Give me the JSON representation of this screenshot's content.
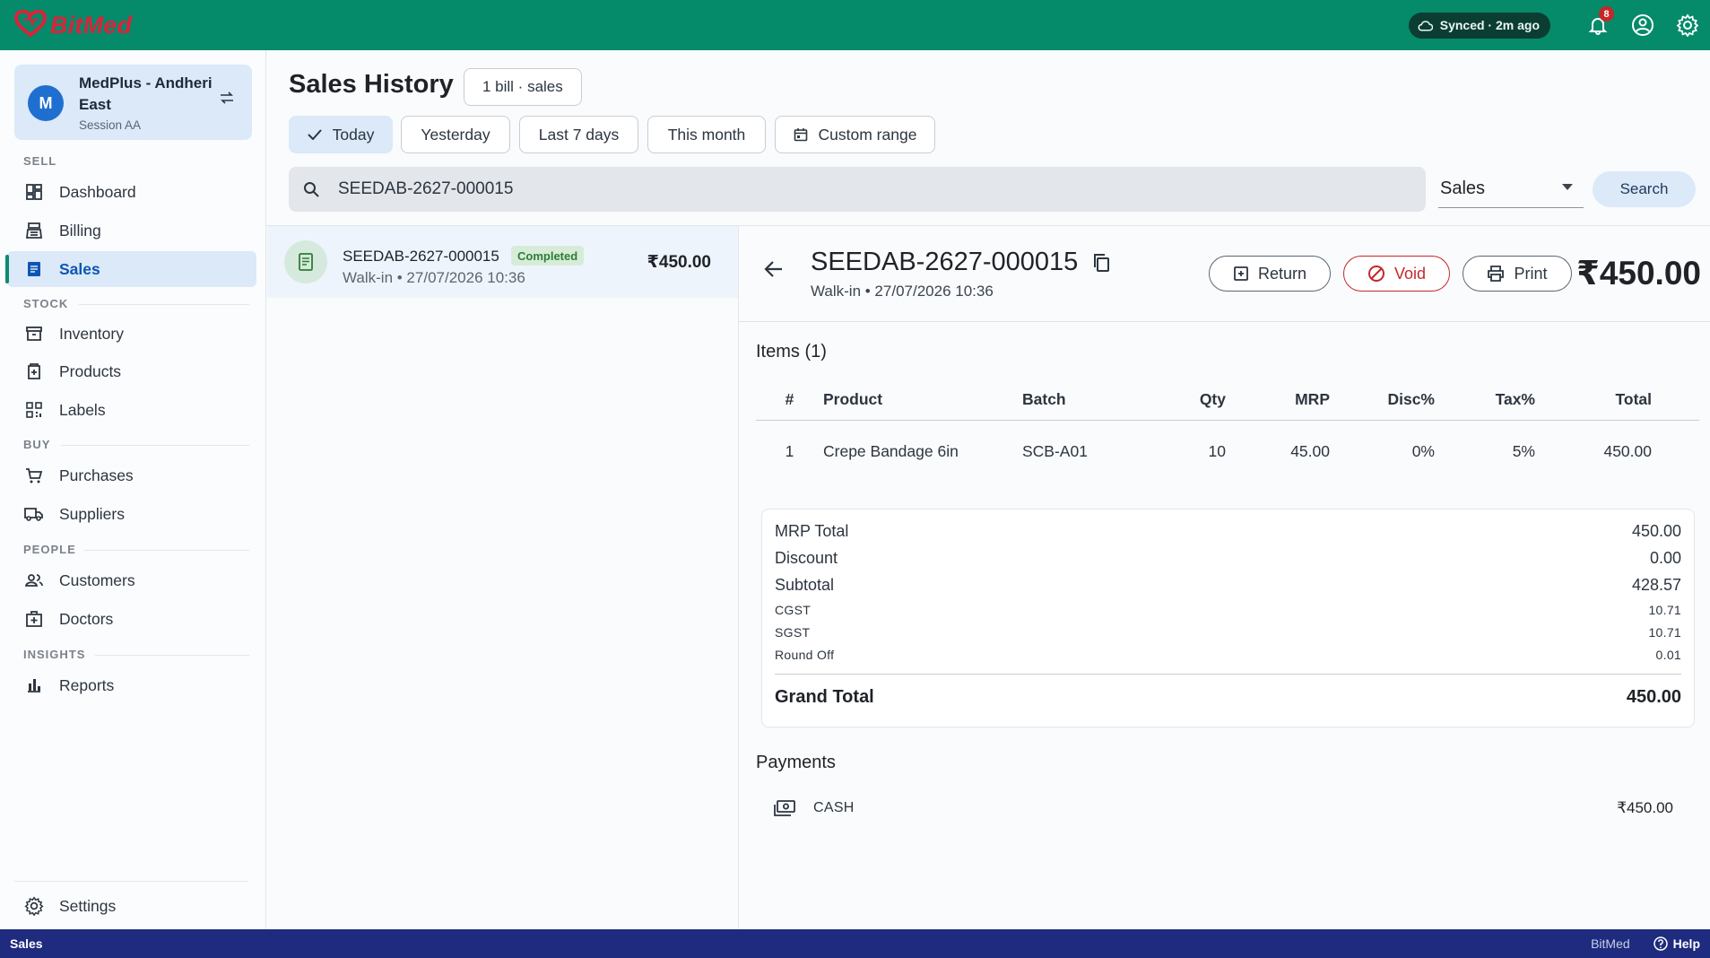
{
  "app": {
    "name": "BitMed",
    "sync_status": "Synced · 2m ago",
    "notification_count": "8",
    "brand_color": "#058a6a"
  },
  "store": {
    "avatar_letter": "M",
    "name": "MedPlus - Andheri East",
    "session": "Session AA"
  },
  "nav": {
    "sections": {
      "sell": "SELL",
      "stock": "STOCK",
      "buy": "BUY",
      "people": "PEOPLE",
      "insights": "INSIGHTS"
    },
    "items": [
      {
        "label": "Dashboard",
        "icon": "dashboard-icon"
      },
      {
        "label": "Billing",
        "icon": "billing-icon"
      },
      {
        "label": "Sales",
        "icon": "sales-icon",
        "active": true
      },
      {
        "label": "Inventory",
        "icon": "inventory-icon"
      },
      {
        "label": "Products",
        "icon": "products-icon"
      },
      {
        "label": "Labels",
        "icon": "qr-code-icon"
      },
      {
        "label": "Purchases",
        "icon": "cart-icon"
      },
      {
        "label": "Suppliers",
        "icon": "truck-icon"
      },
      {
        "label": "Customers",
        "icon": "people-icon"
      },
      {
        "label": "Doctors",
        "icon": "medical-bag-icon"
      },
      {
        "label": "Reports",
        "icon": "bar-chart-icon"
      }
    ],
    "settings": "Settings"
  },
  "header": {
    "title": "Sales History",
    "count_chip": "1 bill · sales",
    "filters": [
      "Today",
      "Yesterday",
      "Last 7 days",
      "This month",
      "Custom range"
    ],
    "selected_filter": "Today"
  },
  "search": {
    "value": "SEEDAB-2627-000015",
    "type": "Sales",
    "button": "Search"
  },
  "bills": [
    {
      "number": "SEEDAB-2627-000015",
      "status": "Completed",
      "customer_date": "Walk-in • 27/07/2026 10:36",
      "amount": "₹450.00"
    }
  ],
  "detail": {
    "number": "SEEDAB-2627-000015",
    "subtitle": "Walk-in • 27/07/2026 10:36",
    "amount": "₹450.00",
    "actions": {
      "return": "Return",
      "void": "Void",
      "print": "Print"
    },
    "items_title": "Items (1)",
    "columns": [
      "#",
      "Product",
      "Batch",
      "Qty",
      "MRP",
      "Disc%",
      "Tax%",
      "Total"
    ],
    "items": [
      {
        "idx": "1",
        "product": "Crepe Bandage 6in",
        "batch": "SCB-A01",
        "qty": "10",
        "mrp": "45.00",
        "disc": "0%",
        "tax": "5%",
        "total": "450.00"
      }
    ],
    "totals": {
      "mrp_total": {
        "label": "MRP Total",
        "value": "450.00"
      },
      "discount": {
        "label": "Discount",
        "value": "0.00"
      },
      "subtotal": {
        "label": "Subtotal",
        "value": "428.57"
      },
      "cgst": {
        "label": "CGST",
        "value": "10.71"
      },
      "sgst": {
        "label": "SGST",
        "value": "10.71"
      },
      "round_off": {
        "label": "Round Off",
        "value": "0.01"
      },
      "grand_total": {
        "label": "Grand Total",
        "value": "450.00"
      }
    },
    "payments_title": "Payments",
    "payments": [
      {
        "method": "CASH",
        "amount": "₹450.00"
      }
    ]
  },
  "statusbar": {
    "left": "Sales",
    "brand": "BitMed",
    "help": "Help"
  }
}
